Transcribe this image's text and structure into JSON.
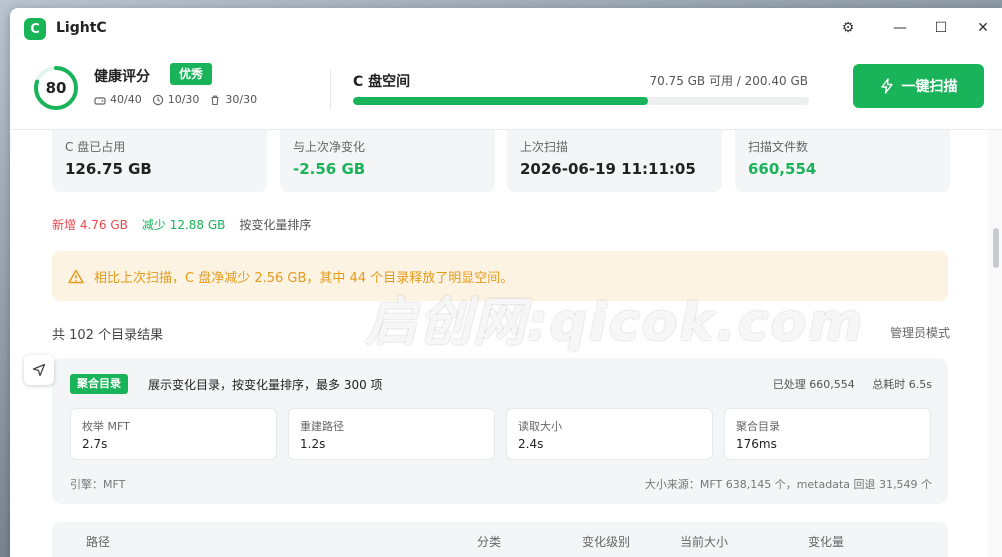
{
  "app": {
    "title": "LightC",
    "logo_letter": "C"
  },
  "window_controls": {
    "settings": "⚙",
    "minimize": "—",
    "maximize": "☐",
    "close": "✕"
  },
  "health": {
    "score": "80",
    "score_fraction": 0.8,
    "title": "健康评分",
    "badge": "优秀",
    "stats": [
      "40/40",
      "10/30",
      "30/30"
    ]
  },
  "disk": {
    "title": "C 盘空间",
    "info": "70.75 GB 可用 / 200.40 GB",
    "used_fraction": 0.647
  },
  "scan_button": {
    "label": "一键扫描"
  },
  "stat_cards": [
    {
      "label": "C 盘已占用",
      "value": "126.75 GB",
      "green": false
    },
    {
      "label": "与上次净变化",
      "value": "-2.56 GB",
      "green": true
    },
    {
      "label": "上次扫描",
      "value": "2026-06-19 11:11:05",
      "green": false
    },
    {
      "label": "扫描文件数",
      "value": "660,554",
      "green": true
    }
  ],
  "changes": {
    "added": "新增 4.76 GB",
    "reduced": "减少 12.88 GB",
    "sort": "按变化量排序"
  },
  "alert": {
    "text": "相比上次扫描，C 盘净减少 2.56 GB，其中 44 个目录释放了明显空间。"
  },
  "results": {
    "title": "共 102 个目录结果",
    "admin": "管理员模式"
  },
  "watermark": "启创网:qicok.com",
  "aggregate": {
    "badge": "聚合目录",
    "desc": "展示变化目录，按变化量排序，最多 300 项",
    "processed": "已处理 660,554",
    "elapsed": "总耗时 6.5s",
    "steps": [
      {
        "label": "枚举 MFT",
        "value": "2.7s"
      },
      {
        "label": "重建路径",
        "value": "1.2s"
      },
      {
        "label": "读取大小",
        "value": "2.4s"
      },
      {
        "label": "聚合目录",
        "value": "176ms"
      }
    ],
    "engine": "引擎：MFT",
    "source": "大小来源：MFT 638,145 个，metadata 回退 31,549 个"
  },
  "table": {
    "headers": [
      "路径",
      "分类",
      "变化级别",
      "当前大小",
      "变化量"
    ]
  },
  "colors": {
    "accent": "#19b35a",
    "warning": "#e39a1b",
    "danger": "#e5484d"
  }
}
